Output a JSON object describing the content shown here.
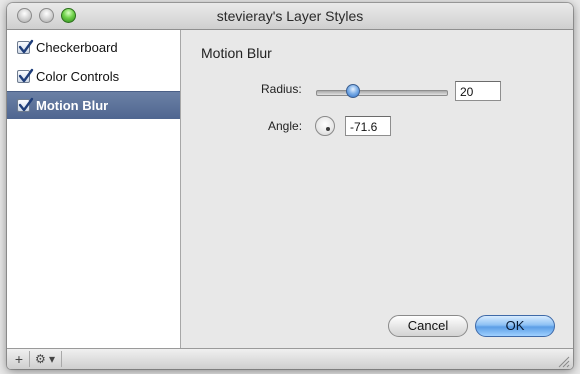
{
  "window": {
    "title": "stevieray's Layer Styles"
  },
  "sidebar": {
    "items": [
      {
        "label": "Checkerboard",
        "checked": true,
        "selected": false
      },
      {
        "label": "Color Controls",
        "checked": true,
        "selected": false
      },
      {
        "label": "Motion Blur",
        "checked": true,
        "selected": true
      }
    ]
  },
  "panel": {
    "title": "Motion Blur",
    "radius": {
      "label": "Radius:",
      "value": "20",
      "slider_fraction": 0.25
    },
    "angle": {
      "label": "Angle:",
      "value": "-71.6"
    }
  },
  "buttons": {
    "cancel": "Cancel",
    "ok": "OK"
  },
  "bottom_bar": {
    "add": "+",
    "gear": "⚙ ▾"
  },
  "colors": {
    "selection": "#5a709b",
    "accent_blue": "#5c9ee6"
  }
}
